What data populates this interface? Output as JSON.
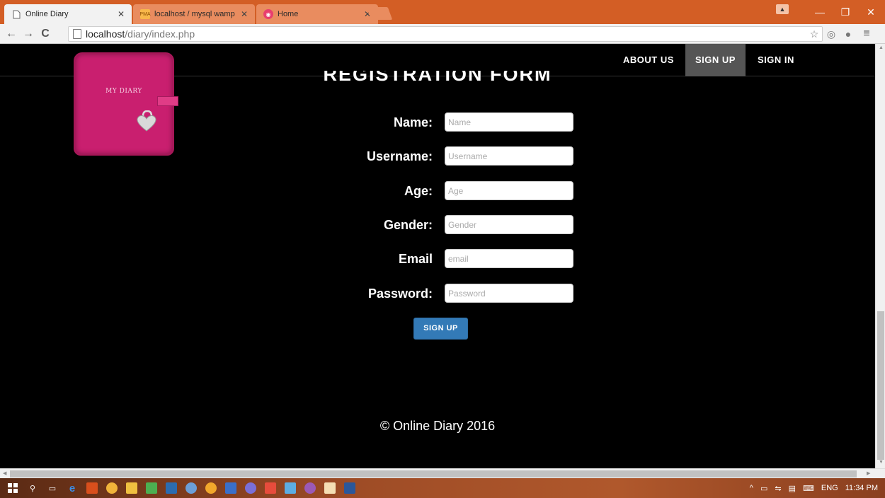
{
  "browser": {
    "tabs": [
      {
        "title": "Online Diary",
        "active": true
      },
      {
        "title": "localhost / mysql wampse",
        "active": false
      },
      {
        "title": "Home",
        "active": false
      }
    ],
    "address": {
      "host": "localhost",
      "path": "/diary/index.php"
    }
  },
  "nav": {
    "items": [
      {
        "label": "ABOUT US"
      },
      {
        "label": "SIGN UP",
        "active": true
      },
      {
        "label": "SIGN IN"
      }
    ]
  },
  "logo": {
    "text": "MY DIARY"
  },
  "form": {
    "title": "REGISTRATION FORM",
    "fields": [
      {
        "label": "Name:",
        "placeholder": "Name"
      },
      {
        "label": "Username:",
        "placeholder": "Username"
      },
      {
        "label": "Age:",
        "placeholder": "Age"
      },
      {
        "label": "Gender:",
        "placeholder": "Gender"
      },
      {
        "label": "Email",
        "placeholder": "email"
      },
      {
        "label": "Password:",
        "placeholder": "Password"
      }
    ],
    "submit_label": "SIGN UP"
  },
  "footer": {
    "text": "© Online Diary 2016"
  },
  "taskbar": {
    "language": "ENG",
    "time": "11:34 PM"
  },
  "colors": {
    "page_bg": "#000000",
    "chrome_accent": "#d35e25",
    "diary_pink": "#c91f6f",
    "button_blue": "#337ab7",
    "nav_active": "#555555"
  }
}
